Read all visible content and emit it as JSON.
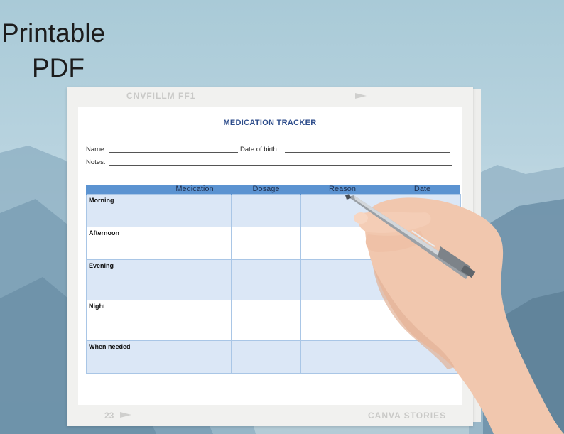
{
  "promo": {
    "line1": "Printable",
    "line2": "PDF"
  },
  "film": {
    "code": "CNVFILLM FF1",
    "frame_number": "23",
    "brand": "CANVA STORIES"
  },
  "sheet": {
    "title": "MEDICATION TRACKER",
    "name_label": "Name:",
    "dob_label": "Date of birth:",
    "notes_label": "Notes:"
  },
  "table": {
    "headers": [
      "",
      "Medication",
      "Dosage",
      "Reason",
      "Date"
    ],
    "rows": [
      {
        "label": "Morning"
      },
      {
        "label": "Afternoon"
      },
      {
        "label": "Evening"
      },
      {
        "label": "Night"
      },
      {
        "label": "When needed"
      }
    ]
  },
  "colors": {
    "accent": "#2f4e8c",
    "header_bar": "#5b93d1",
    "row_shade": "#dbe7f6"
  }
}
